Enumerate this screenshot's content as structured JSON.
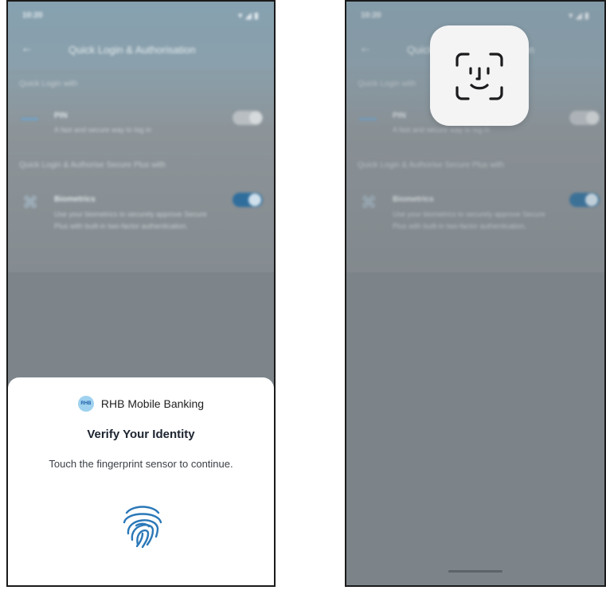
{
  "left_phone": {
    "status": {
      "time": "10:20",
      "icons": "▾◢▮"
    },
    "app_bar": {
      "title": "Quick Login & Authorisation"
    },
    "section_quick_login": "Quick Login with",
    "pin": {
      "title": "PIN",
      "description": "A fast and secure way to log in",
      "enabled": false
    },
    "section_secure_plus": "Quick Login & Authorise Secure Plus with",
    "biometrics": {
      "title": "Biometrics",
      "description": "Use your biometrics to securely approve Secure Plus with built-in two-factor authentication.",
      "enabled": true
    },
    "sheet": {
      "app_logo_text": "RHB",
      "app_name": "RHB Mobile Banking",
      "title": "Verify Your Identity",
      "subtitle": "Touch the fingerprint sensor to continue.",
      "icon": "fingerprint-icon"
    }
  },
  "right_phone": {
    "status": {
      "time": "10:20",
      "icons": "▾◢▮"
    },
    "app_bar": {
      "title": "Quick Login & Authorisation"
    },
    "section_quick_login": "Quick Login with",
    "pin": {
      "title": "PIN",
      "description": "A fast and secure way to log in",
      "enabled": false
    },
    "section_secure_plus": "Quick Login & Authorise Secure Plus with",
    "biometrics": {
      "title": "Biometrics",
      "description": "Use your biometrics to securely approve Secure Plus with built-in two-factor authentication.",
      "enabled": true
    },
    "faceid_icon": "face-id-icon"
  },
  "colors": {
    "accent": "#2f6e9c",
    "fingerprint": "#2a78b8",
    "sheet_background": "#ffffff",
    "scrim": "#7d858a"
  }
}
